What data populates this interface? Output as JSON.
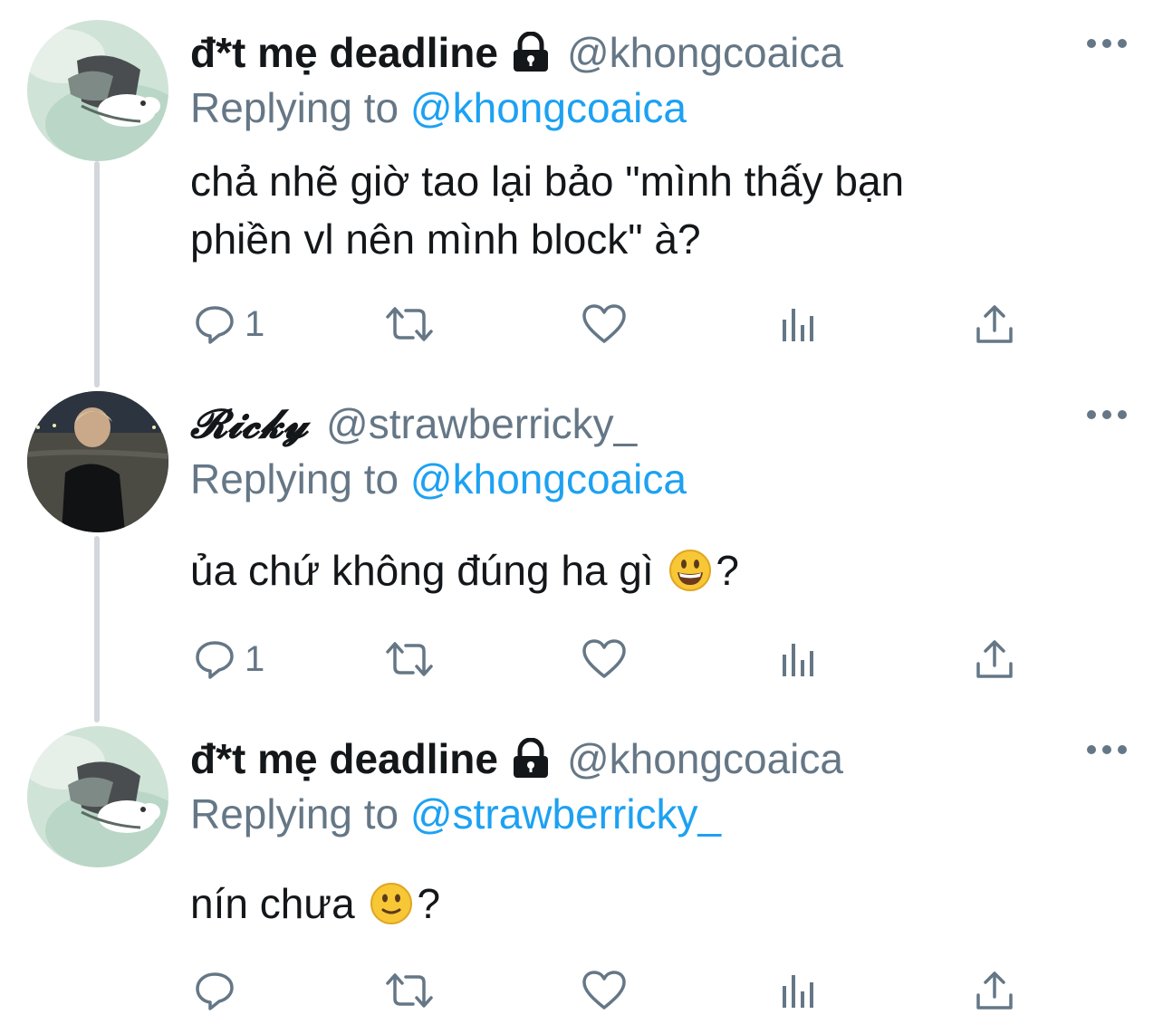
{
  "tweets": [
    {
      "display_name": "đ*t mẹ deadline",
      "protected": true,
      "handle": "@khongcoaica",
      "replying_prefix": "Replying to",
      "replying_to": "@khongcoaica",
      "text": "chả nhẽ giờ tao lại bảo \"mình thấy bạn\nphiền vl nên mình block\" à?",
      "reply_count": "1"
    },
    {
      "display_name": "𝓡𝓲𝓬𝓴𝔂",
      "protected": false,
      "handle": "@strawberricky_",
      "replying_prefix": "Replying to",
      "replying_to": "@khongcoaica",
      "text_before": "ủa chứ không đúng ha gì",
      "emoji": "grinning-face",
      "text_after": "?",
      "reply_count": "1"
    },
    {
      "display_name": "đ*t mẹ deadline",
      "protected": true,
      "handle": "@khongcoaica",
      "replying_prefix": "Replying to",
      "replying_to": "@strawberricky_",
      "text_before": "nín chưa",
      "emoji": "slightly-smiling-face",
      "text_after": "?",
      "reply_count": ""
    }
  ],
  "icons": {
    "reply": "reply-icon",
    "retweet": "retweet-icon",
    "like": "heart-icon",
    "analytics": "analytics-icon",
    "share": "share-icon",
    "more": "more-icon",
    "lock": "lock-icon"
  },
  "colors": {
    "text": "#14171a",
    "secondary": "#657786",
    "link": "#1da1f2",
    "thread_line": "#d3d7db"
  }
}
